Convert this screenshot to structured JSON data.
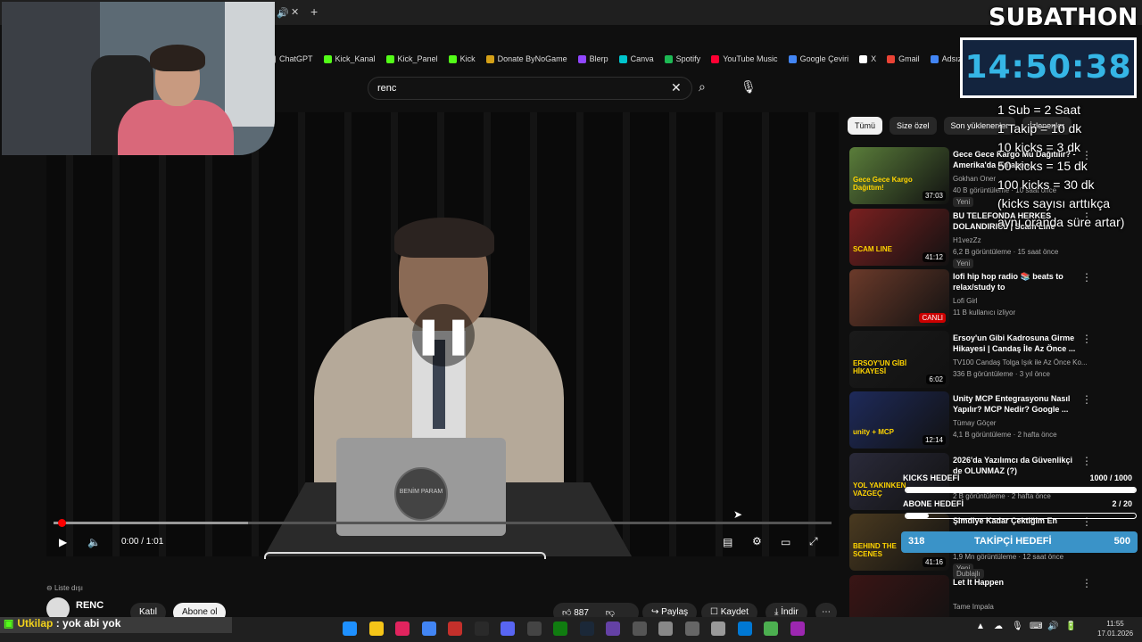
{
  "browser": {
    "new_tab_symbol": "+",
    "close_symbol": "✕",
    "bookmarks": [
      {
        "label": "ChatGPT",
        "color": "#aaaaaa"
      },
      {
        "label": "Kick_Kanal",
        "color": "#53fc18"
      },
      {
        "label": "Kick_Panel",
        "color": "#53fc18"
      },
      {
        "label": "Kick",
        "color": "#53fc18"
      },
      {
        "label": "Donate ByNoGame",
        "color": "#d4a017"
      },
      {
        "label": "Blerp",
        "color": "#9146ff"
      },
      {
        "label": "Canva",
        "color": "#00c4cc"
      },
      {
        "label": "Spotify",
        "color": "#1db954"
      },
      {
        "label": "YouTube Music",
        "color": "#ff0033"
      },
      {
        "label": "Google Çeviri",
        "color": "#4285f4"
      },
      {
        "label": "X",
        "color": "#ffffff"
      },
      {
        "label": "Gmail",
        "color": "#ea4335"
      },
      {
        "label": "Adsız doküman - G...",
        "color": "#4285f4"
      }
    ]
  },
  "search": {
    "query": "renc"
  },
  "player": {
    "time": "0:00 / 1:01",
    "progress_fraction": 0.0,
    "buffered_fraction": 0.25,
    "desk_logo": "BENİM PARAM"
  },
  "chips": [
    "Tümü",
    "Size özel",
    "Son yüklenenler",
    "İzlenenler"
  ],
  "recommendations": [
    {
      "title": "Gece Gece Kargo Mu Dağıtılır? - Amerika'da Amazon...",
      "channel": "Gokhan Oner",
      "meta": "40 B görüntüleme · 10 saat önce",
      "badge": "Yeni",
      "duration": "37:03",
      "thumb_text": "Gece Gece Kargo Dağıttım!",
      "thumb_color": "#5a7d3a"
    },
    {
      "title": "BU TELEFONDA HERKES DOLANDIRICI! | Scam Line",
      "channel": "H1vezZz",
      "meta": "6,2 B görüntüleme · 15 saat önce",
      "badge": "Yeni",
      "duration": "41:12",
      "thumb_text": "SCAM LINE",
      "thumb_color": "#7a2020"
    },
    {
      "title": "lofi hip hop radio 📚 beats to relax/study to",
      "channel": "Lofi Girl",
      "meta": "11 B kullanıcı izliyor",
      "badge": "",
      "duration": "CANLI",
      "thumb_text": "",
      "thumb_color": "#6b3a2a"
    },
    {
      "title": "Ersoy'un Gibi Kadrosuna Girme Hikayesi | Candaş İle Az Önce ...",
      "channel": "TV100 Candaş Tolga Işık ile Az Önce Ko...",
      "meta": "336 B görüntüleme · 3 yıl önce",
      "badge": "",
      "duration": "6:02",
      "thumb_text": "ERSOY'UN GİBİ HİKAYESİ",
      "thumb_color": "#1a1a1a"
    },
    {
      "title": "Unity MCP Entegrasyonu Nasıl Yapılır? MCP Nedir? Google ...",
      "channel": "Tümay Göçer",
      "meta": "4,1 B görüntüleme · 2 hafta önce",
      "badge": "",
      "duration": "12:14",
      "thumb_text": "unity + MCP",
      "thumb_color": "#1e2a5a"
    },
    {
      "title": "2026'da Yazılımcı da Güvenlikçi de OLUNMAZ (?)",
      "channel": "",
      "meta": "2 B görüntüleme · 2 hafta önce",
      "badge": "",
      "duration": "",
      "thumb_text": "YOL YAKINKEN VAZGEÇ",
      "thumb_color": "#2a2a3a"
    },
    {
      "title": "Şimdiye Kadar Çektiğim En",
      "channel": "",
      "meta": "1,9 Mn görüntüleme · 12 saat önce",
      "badge": "Yeni",
      "badge2": "Dublajlı",
      "duration": "41:16",
      "thumb_text": "BEHIND THE SCENES",
      "thumb_color": "#4a3a20"
    },
    {
      "title": "Let It Happen",
      "channel": "Tame Impala",
      "meta": "",
      "badge": "",
      "duration": "",
      "thumb_text": "",
      "thumb_color": "#3a1515"
    }
  ],
  "below_video": {
    "playlist_label": "Liste dışı",
    "channel": "RENC",
    "join": "Katıl",
    "subscribe": "Abone ol",
    "likes": "887",
    "share": "Paylaş",
    "save": "Kaydet",
    "download": "İndir"
  },
  "overlay": {
    "subathon_title": "SUBATHON",
    "timer": "14:50:38",
    "rules": [
      "1 Sub = 2 Saat",
      "1 Takip = 10 dk",
      "10 kicks = 3 dk",
      "50 kicks = 15 dk",
      "100 kicks = 30 dk",
      "(kicks sayısı arttıkça",
      "aynı oranda süre artar)"
    ],
    "kicks_goal": {
      "label": "KICKS HEDEFİ",
      "value": "1000 / 1000",
      "fraction": 1.0
    },
    "sub_goal": {
      "label": "ABONE HEDEFİ",
      "value": "2 / 20",
      "fraction": 0.1
    },
    "follower_goal": {
      "current": "318",
      "label": "TAKİPÇİ HEDEFİ",
      "target": "500"
    }
  },
  "chat_message": {
    "user": "Utkilap",
    "text": " : yok abi yok",
    "user_color": "#f2d21b"
  },
  "taskbar": {
    "time": "11:55",
    "date": "17.01.2026"
  },
  "colors": {
    "accent": "#ff0000",
    "timer": "#35b6e6",
    "goal": "#3a93c8"
  }
}
